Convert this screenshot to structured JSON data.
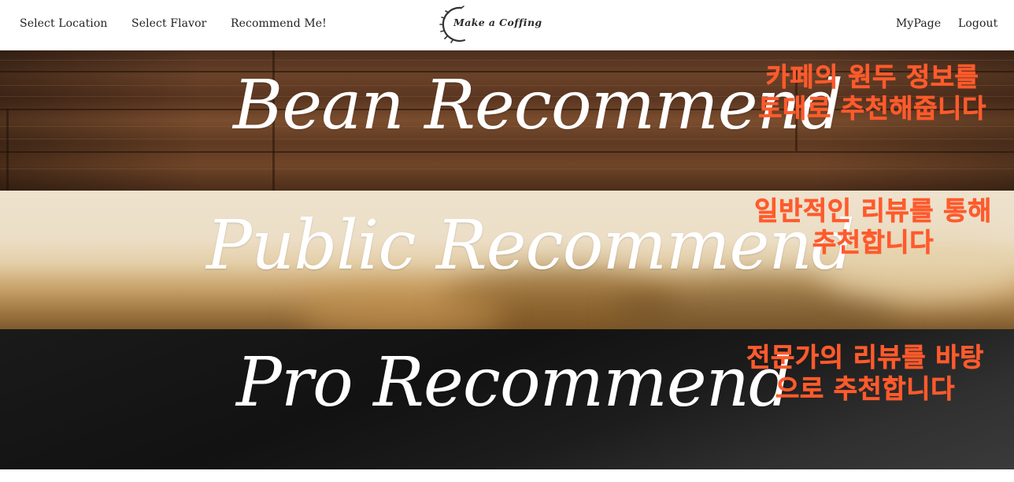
{
  "nav": {
    "left_links": [
      {
        "label": "Select Location"
      },
      {
        "label": "Select Flavor"
      },
      {
        "label": "Recommend Me!"
      }
    ],
    "logo_text": "Make a Coffing",
    "right_links": [
      {
        "label": "MyPage"
      },
      {
        "label": "Logout"
      }
    ]
  },
  "banners": {
    "bean": {
      "title": "Bean Recommend",
      "description_lines": [
        "카페의 원두 정보를",
        "토대로 추천해줍니다"
      ]
    },
    "public": {
      "title": "Public Recommend",
      "description_lines": [
        "일반적인 리뷰를 통해",
        "추천합니다"
      ]
    },
    "pro": {
      "title": "Pro Recommend",
      "description_lines": [
        "전문가의 리뷰를 바탕",
        "으로 추천합니다"
      ]
    }
  },
  "colors": {
    "description_accent": "#ff5a2c",
    "title_text": "#ffffff",
    "nav_text": "#222222"
  }
}
